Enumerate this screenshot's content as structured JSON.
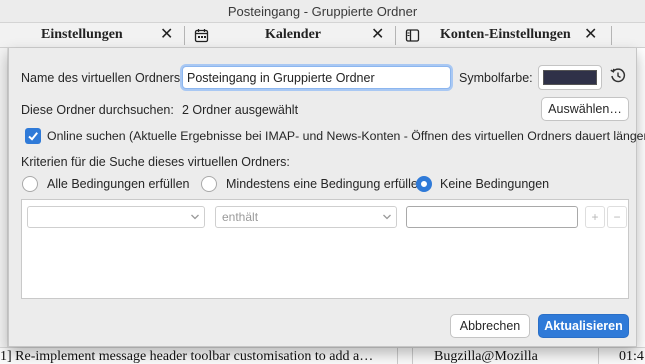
{
  "window": {
    "title": "Posteingang - Gruppierte Ordner"
  },
  "tabs": [
    {
      "label": "Einstellungen",
      "icon": "none"
    },
    {
      "label": "Kalender",
      "icon": "calendar-icon"
    },
    {
      "label": "Konten-Einstellungen",
      "icon": "book-icon"
    }
  ],
  "tab_close_glyph": "✕",
  "background_row": {
    "subject": "1] Re-implement message header toolbar customisation to add a…",
    "sender": "Bugzilla@Mozilla",
    "time": "01:4"
  },
  "dialog": {
    "name_label": "Name des virtuellen Ordners:",
    "name_value": "Posteingang in Gruppierte Ordner",
    "color_label": "Symbolfarbe:",
    "color_value": "#2f3148",
    "search_folders_label": "Diese Ordner durchsuchen:",
    "search_folders_value": "2 Ordner ausgewählt",
    "choose_button": "Auswählen…",
    "online_search_label": "Online suchen (Aktuelle Ergebnisse bei IMAP- und News-Konten - Öffnen des virtuellen Ordners dauert länger)",
    "online_search_checked": true,
    "criteria_label": "Kriterien für die Suche dieses virtuellen Ordners:",
    "match_options": [
      {
        "label": "Alle Bedingungen erfüllen",
        "checked": false
      },
      {
        "label": "Mindestens eine Bedingung erfüllen",
        "checked": false
      },
      {
        "label": "Keine Bedingungen",
        "checked": true
      }
    ],
    "rule": {
      "field_value": "",
      "operator_value": "enthält",
      "text_value": "",
      "add_label": "+",
      "remove_label": "−"
    },
    "cancel_button": "Abbrechen",
    "update_button": "Aktualisieren"
  },
  "colors": {
    "accent": "#2f7ad8"
  }
}
